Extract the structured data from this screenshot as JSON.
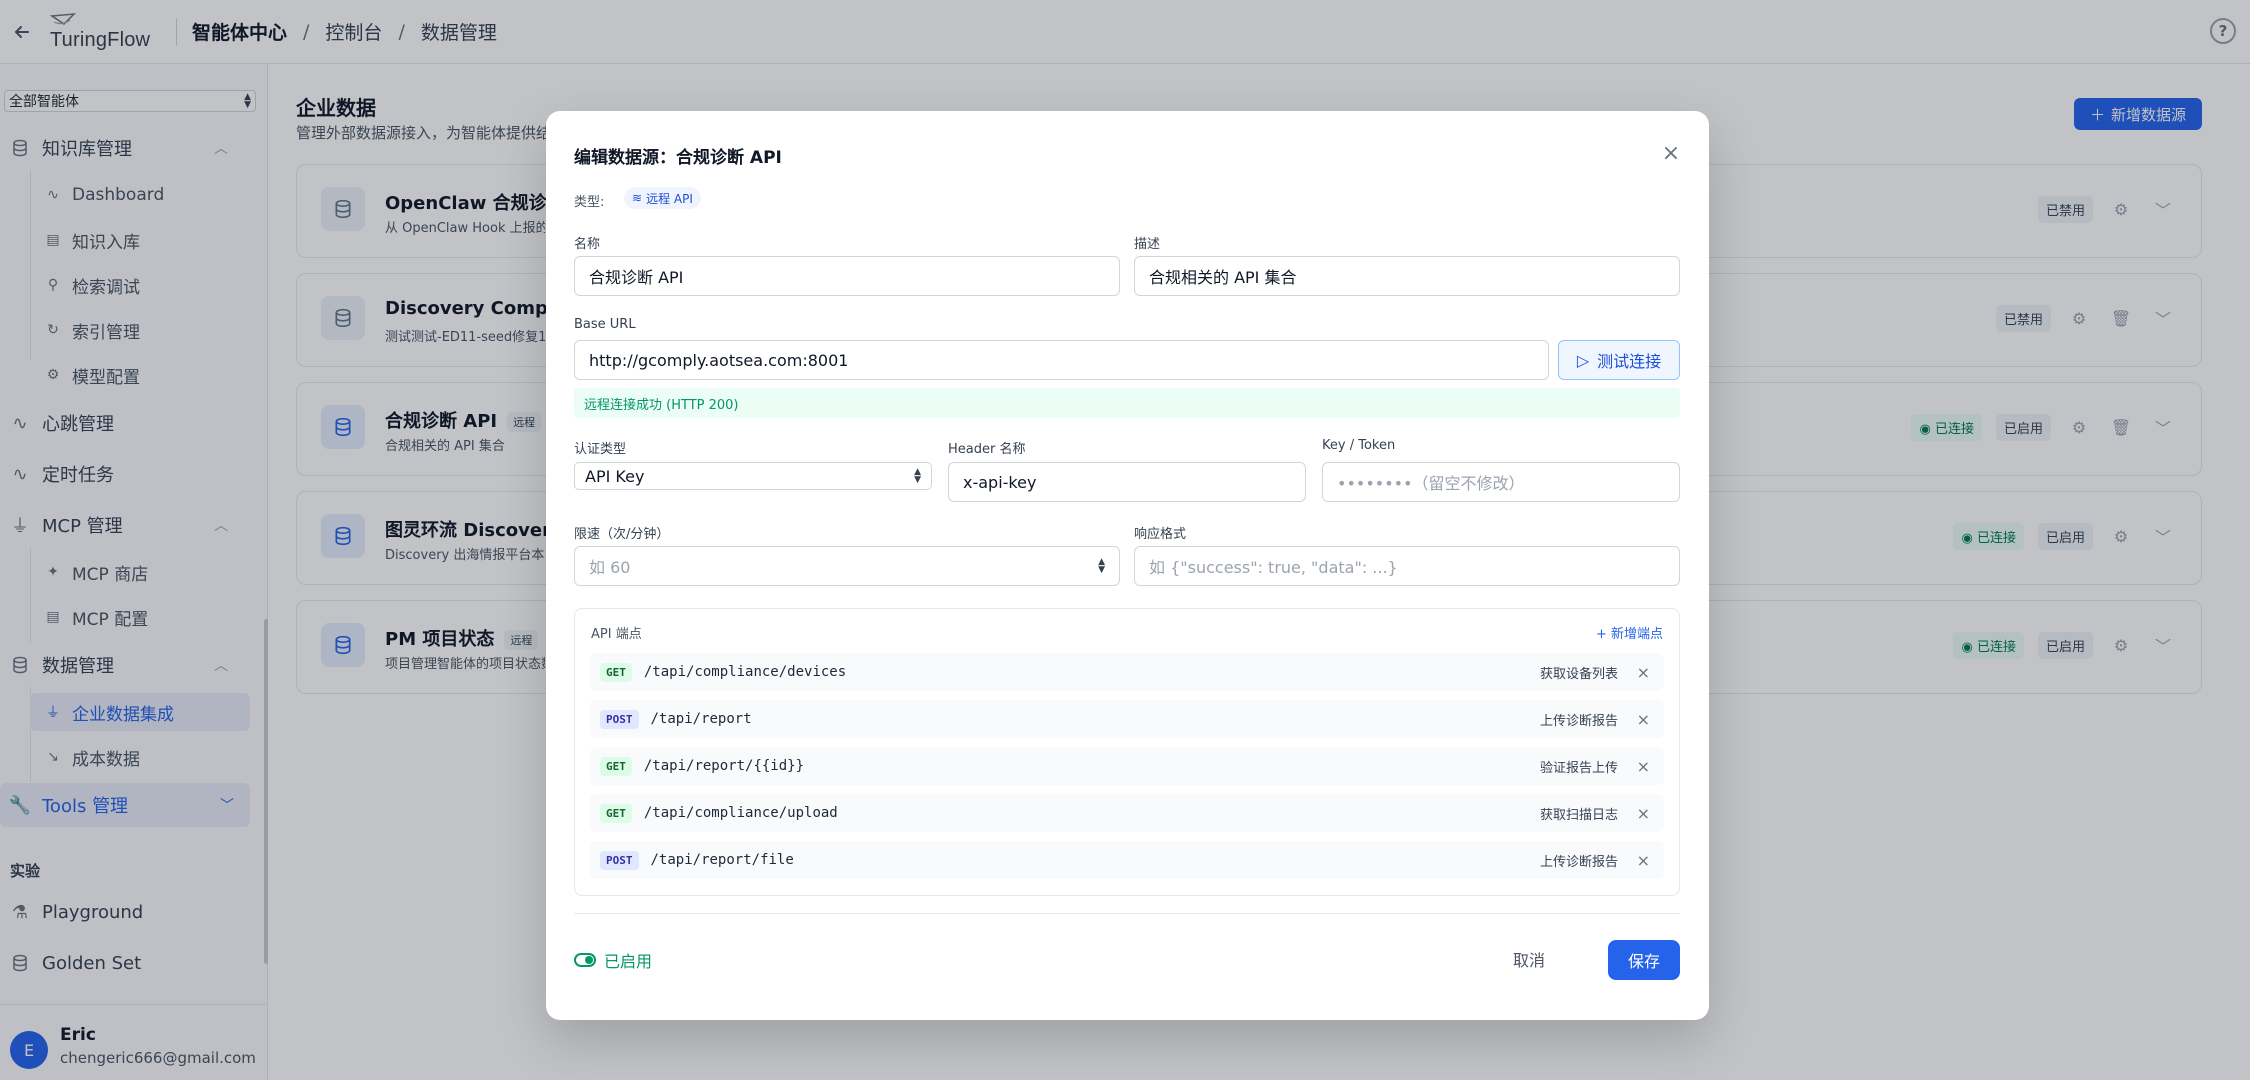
{
  "topbar": {
    "logo_text": "TuringFlow",
    "breadcrumb": [
      "智能体中心",
      "控制台",
      "数据管理"
    ],
    "separator": "/",
    "help_glyph": "?"
  },
  "sidebar": {
    "agent_select": "全部智能体",
    "groups": {
      "knowledge": "知识库管理",
      "heartbeat": "心跳管理",
      "scheduled": "定时任务",
      "mcp": "MCP 管理",
      "data": "数据管理",
      "tools": "Tools 管理"
    },
    "knowledge_items": [
      "Dashboard",
      "知识入库",
      "检索调试",
      "索引管理",
      "模型配置"
    ],
    "mcp_items": [
      "MCP 商店",
      "MCP 配置"
    ],
    "data_items": [
      "企业数据集成",
      "成本数据"
    ],
    "section_experiment": "实验",
    "experiment_items": [
      "Playground",
      "Golden Set"
    ],
    "user": {
      "initial": "E",
      "name": "Eric",
      "email": "chengeric666@gmail.com"
    }
  },
  "main": {
    "title": "企业数据",
    "description": "管理外部数据源接入，为智能体提供结构化数据",
    "add_button": "新增数据源",
    "cards": [
      {
        "name": "OpenClaw 合规诊断",
        "sub": "从 OpenClaw Hook 上报的合规诊断数据",
        "tag": "",
        "badges": [
          "已禁用"
        ],
        "connected": ""
      },
      {
        "name": "Discovery Comply",
        "sub": "测试测试-ED11-seed修复1",
        "tag": "",
        "badges": [
          "已禁用"
        ],
        "connected": ""
      },
      {
        "name": "合规诊断 API",
        "sub": "合规相关的 API 集合",
        "tag": "远程",
        "badges": [
          "已启用"
        ],
        "connected": "已连接"
      },
      {
        "name": "图灵环流 Discovery",
        "sub": "Discovery 出海情报平台本地数据",
        "tag": "",
        "badges": [
          "已启用"
        ],
        "connected": "已连接"
      },
      {
        "name": "PM 项目状态",
        "sub": "项目管理智能体的项目状态数据",
        "tag": "远程",
        "badges": [
          "已启用"
        ],
        "connected": "已连接"
      }
    ]
  },
  "modal": {
    "title": "编辑数据源：合规诊断 API",
    "type_label": "类型:",
    "type_value": "远程 API",
    "name_label": "名称",
    "name_value": "合规诊断 API",
    "desc_label": "描述",
    "desc_value": "合规相关的 API 集合",
    "base_url_label": "Base URL",
    "base_url_value": "http://gcomply.aotsea.com:8001",
    "test_button": "测试连接",
    "test_result": "远程连接成功 (HTTP 200)",
    "auth_label": "认证类型",
    "auth_value": "API Key",
    "header_label": "Header 名称",
    "header_value": "x-api-key",
    "token_label": "Key / Token",
    "token_placeholder": "••••••••（留空不修改）",
    "rate_label": "限速（次/分钟）",
    "rate_placeholder": "如 60",
    "format_label": "响应格式",
    "format_placeholder": "如 {\"success\": true, \"data\": ...}",
    "endpoints_title": "API 端点",
    "endpoints_add": "+ 新增端点",
    "endpoints": [
      {
        "method": "GET",
        "path": "/tapi/compliance/devices",
        "desc": "获取设备列表"
      },
      {
        "method": "POST",
        "path": "/tapi/report",
        "desc": "上传诊断报告"
      },
      {
        "method": "GET",
        "path": "/tapi/report/{{id}}",
        "desc": "验证报告上传"
      },
      {
        "method": "GET",
        "path": "/tapi/compliance/upload",
        "desc": "获取扫描日志"
      },
      {
        "method": "POST",
        "path": "/tapi/report/file",
        "desc": "上传诊断报告"
      }
    ],
    "enabled_label": "已启用",
    "cancel": "取消",
    "save": "保存"
  },
  "colors": {
    "accent": "#2563eb",
    "success": "#059669"
  }
}
